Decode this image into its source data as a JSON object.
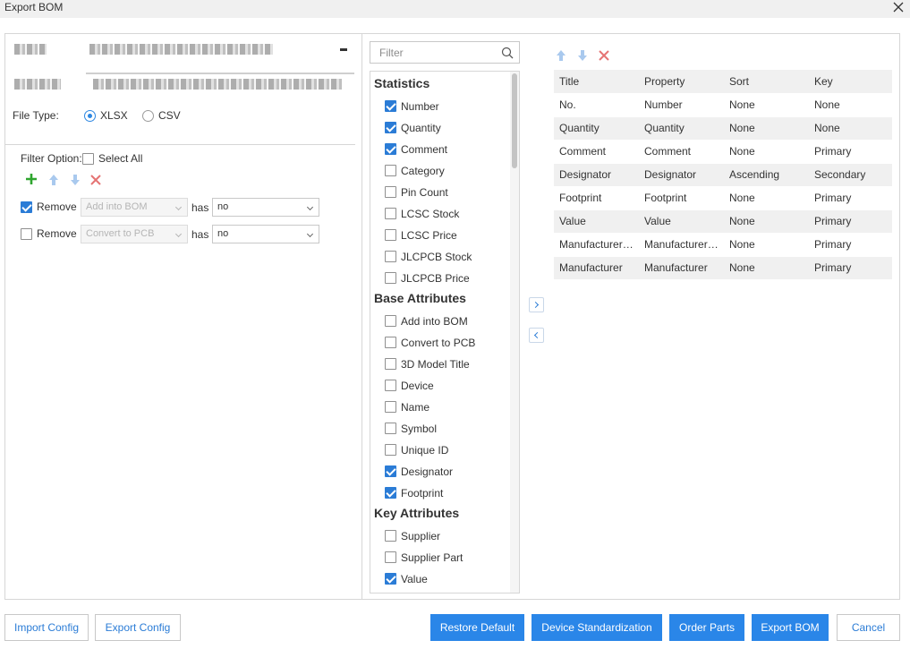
{
  "window": {
    "title": "Export BOM"
  },
  "file_type": {
    "label": "File Type:",
    "options": [
      "XLSX",
      "CSV"
    ],
    "selected": "XLSX"
  },
  "filter_option": {
    "label": "Filter Option:",
    "select_all_label": "Select All",
    "rules": [
      {
        "checked": true,
        "action": "Remove",
        "field": "Add into BOM",
        "has": "has",
        "value": "no"
      },
      {
        "checked": false,
        "action": "Remove",
        "field": "Convert to PCB",
        "has": "has",
        "value": "no"
      }
    ]
  },
  "attributes": {
    "filter_placeholder": "Filter",
    "groups": [
      {
        "title": "Statistics",
        "items": [
          {
            "label": "Number",
            "checked": true
          },
          {
            "label": "Quantity",
            "checked": true
          },
          {
            "label": "Comment",
            "checked": true
          },
          {
            "label": "Category",
            "checked": false
          },
          {
            "label": "Pin Count",
            "checked": false
          },
          {
            "label": "LCSC Stock",
            "checked": false
          },
          {
            "label": "LCSC Price",
            "checked": false
          },
          {
            "label": "JLCPCB Stock",
            "checked": false
          },
          {
            "label": "JLCPCB Price",
            "checked": false
          }
        ]
      },
      {
        "title": "Base Attributes",
        "items": [
          {
            "label": "Add into BOM",
            "checked": false
          },
          {
            "label": "Convert to PCB",
            "checked": false
          },
          {
            "label": "3D Model Title",
            "checked": false
          },
          {
            "label": "Device",
            "checked": false
          },
          {
            "label": "Name",
            "checked": false
          },
          {
            "label": "Symbol",
            "checked": false
          },
          {
            "label": "Unique ID",
            "checked": false
          },
          {
            "label": "Designator",
            "checked": true
          },
          {
            "label": "Footprint",
            "checked": true
          }
        ]
      },
      {
        "title": "Key Attributes",
        "items": [
          {
            "label": "Supplier",
            "checked": false
          },
          {
            "label": "Supplier Part",
            "checked": false
          },
          {
            "label": "Value",
            "checked": true
          }
        ]
      }
    ]
  },
  "columns_table": {
    "headers": [
      "Title",
      "Property",
      "Sort",
      "Key"
    ],
    "rows": [
      [
        "No.",
        "Number",
        "None",
        "None"
      ],
      [
        "Quantity",
        "Quantity",
        "None",
        "None"
      ],
      [
        "Comment",
        "Comment",
        "None",
        "Primary"
      ],
      [
        "Designator",
        "Designator",
        "Ascending",
        "Secondary"
      ],
      [
        "Footprint",
        "Footprint",
        "None",
        "Primary"
      ],
      [
        "Value",
        "Value",
        "None",
        "Primary"
      ],
      [
        "Manufacturer…",
        "Manufacturer…",
        "None",
        "Primary"
      ],
      [
        "Manufacturer",
        "Manufacturer",
        "None",
        "Primary"
      ]
    ]
  },
  "footer": {
    "import_config": "Import Config",
    "export_config": "Export Config",
    "restore_default": "Restore Default",
    "device_standardization": "Device Standardization",
    "order_parts": "Order Parts",
    "export_bom": "Export BOM",
    "cancel": "Cancel"
  },
  "colors": {
    "accent": "#2a86e8",
    "add": "#2fa52f",
    "delete": "#e57373",
    "arrow": "#a9c9ee"
  }
}
